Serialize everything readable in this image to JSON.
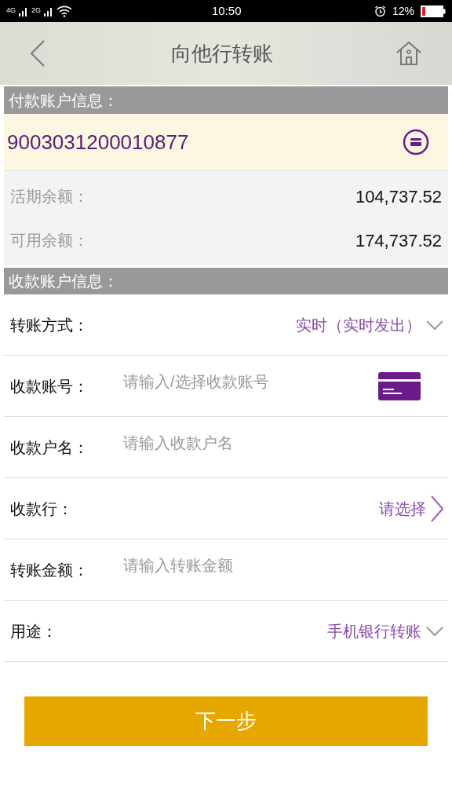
{
  "status_bar": {
    "network_1": "4G",
    "network_2": "2G",
    "time": "10:50",
    "battery": "12%"
  },
  "header": {
    "title": "向他行转账"
  },
  "payer_section": {
    "title": "付款账户信息：",
    "account": "9003031200010877",
    "balances": [
      {
        "label": "活期余额：",
        "value": "104,737.52"
      },
      {
        "label": "可用余额：",
        "value": "174,737.52"
      }
    ]
  },
  "payee_section": {
    "title": "收款账户信息：",
    "rows": [
      {
        "kind": "select",
        "label": "转账方式：",
        "value": "实时（实时发出）"
      },
      {
        "kind": "account_input",
        "label": "收款账号：",
        "placeholder": "请输入/选择收款账号"
      },
      {
        "kind": "input",
        "label": "收款户名：",
        "placeholder": "请输入收款户名"
      },
      {
        "kind": "picker",
        "label": "收款行：",
        "value": "请选择"
      },
      {
        "kind": "input",
        "label": "转账金额：",
        "placeholder": "请输入转账金额"
      },
      {
        "kind": "select",
        "label": "用途：",
        "value": "手机银行转账"
      }
    ]
  },
  "next_button": "下一步"
}
